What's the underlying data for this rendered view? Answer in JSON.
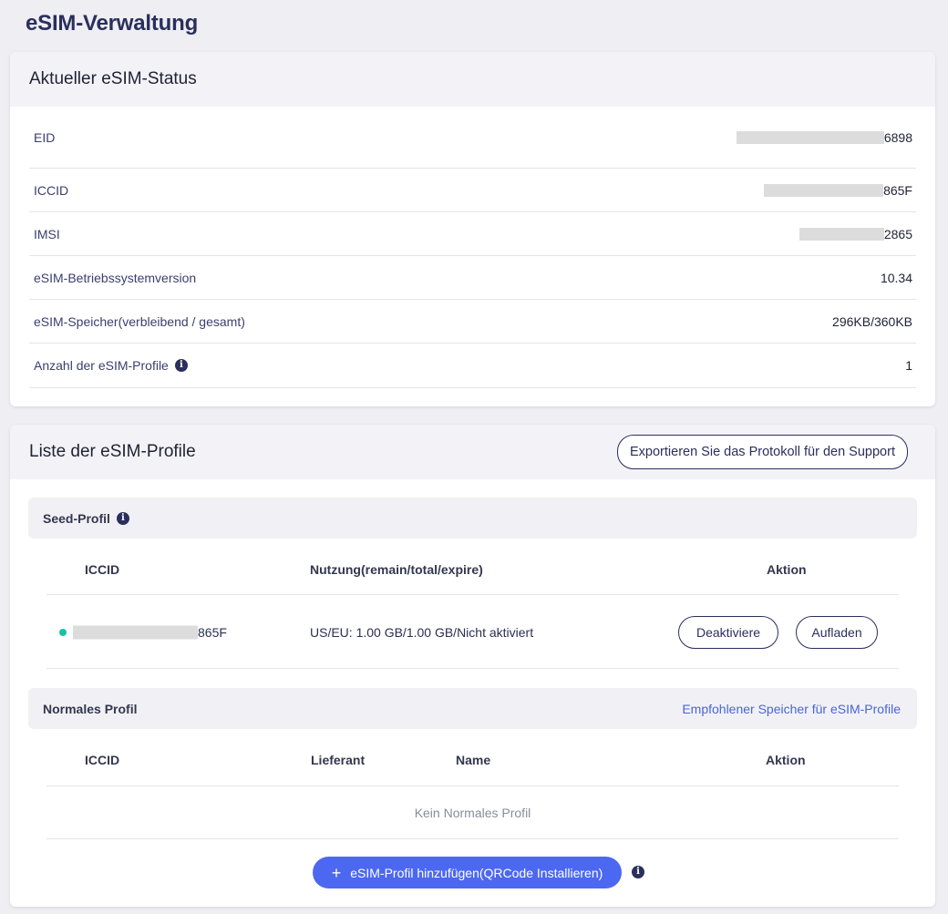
{
  "page": {
    "title": "eSIM-Verwaltung"
  },
  "status": {
    "title": "Aktueller eSIM-Status",
    "rows": [
      {
        "label": "EID",
        "value": "6898"
      },
      {
        "label": "ICCID",
        "value": "865F"
      },
      {
        "label": "IMSI",
        "value": "2865"
      },
      {
        "label": "eSIM-Betriebssystemversion",
        "value": "10.34"
      },
      {
        "label": "eSIM-Speicher(verbleibend / gesamt)",
        "value": "296KB/360KB"
      },
      {
        "label": "Anzahl der eSIM-Profile",
        "value": "1"
      }
    ]
  },
  "profiles": {
    "title": "Liste der eSIM-Profile",
    "export_label": "Exportieren Sie das Protokoll für den Support",
    "seed": {
      "section_label": "Seed-Profil",
      "columns": {
        "iccid": "ICCID",
        "usage": "Nutzung(remain/total/expire)",
        "action": "Aktion"
      },
      "row": {
        "iccid_suffix": "865F",
        "usage": "US/EU: 1.00 GB/1.00 GB/Nicht aktiviert",
        "deactivate_label": "Deaktiviere",
        "recharge_label": "Aufladen",
        "status_color": "#17c1a9"
      }
    },
    "normal": {
      "section_label": "Normales Profil",
      "link_label": "Empfohlener Speicher für eSIM-Profile",
      "columns": {
        "iccid": "ICCID",
        "supplier": "Lieferant",
        "name": "Name",
        "action": "Aktion"
      },
      "empty_label": "Kein Normales Profil"
    },
    "add_button": {
      "icon": "+",
      "label": "eSIM-Profil hinzufügen(QRCode Installieren)"
    }
  },
  "colors": {
    "accent": "#4c68f0",
    "navy": "#2a2f5c",
    "active_dot": "#17c1a9"
  }
}
